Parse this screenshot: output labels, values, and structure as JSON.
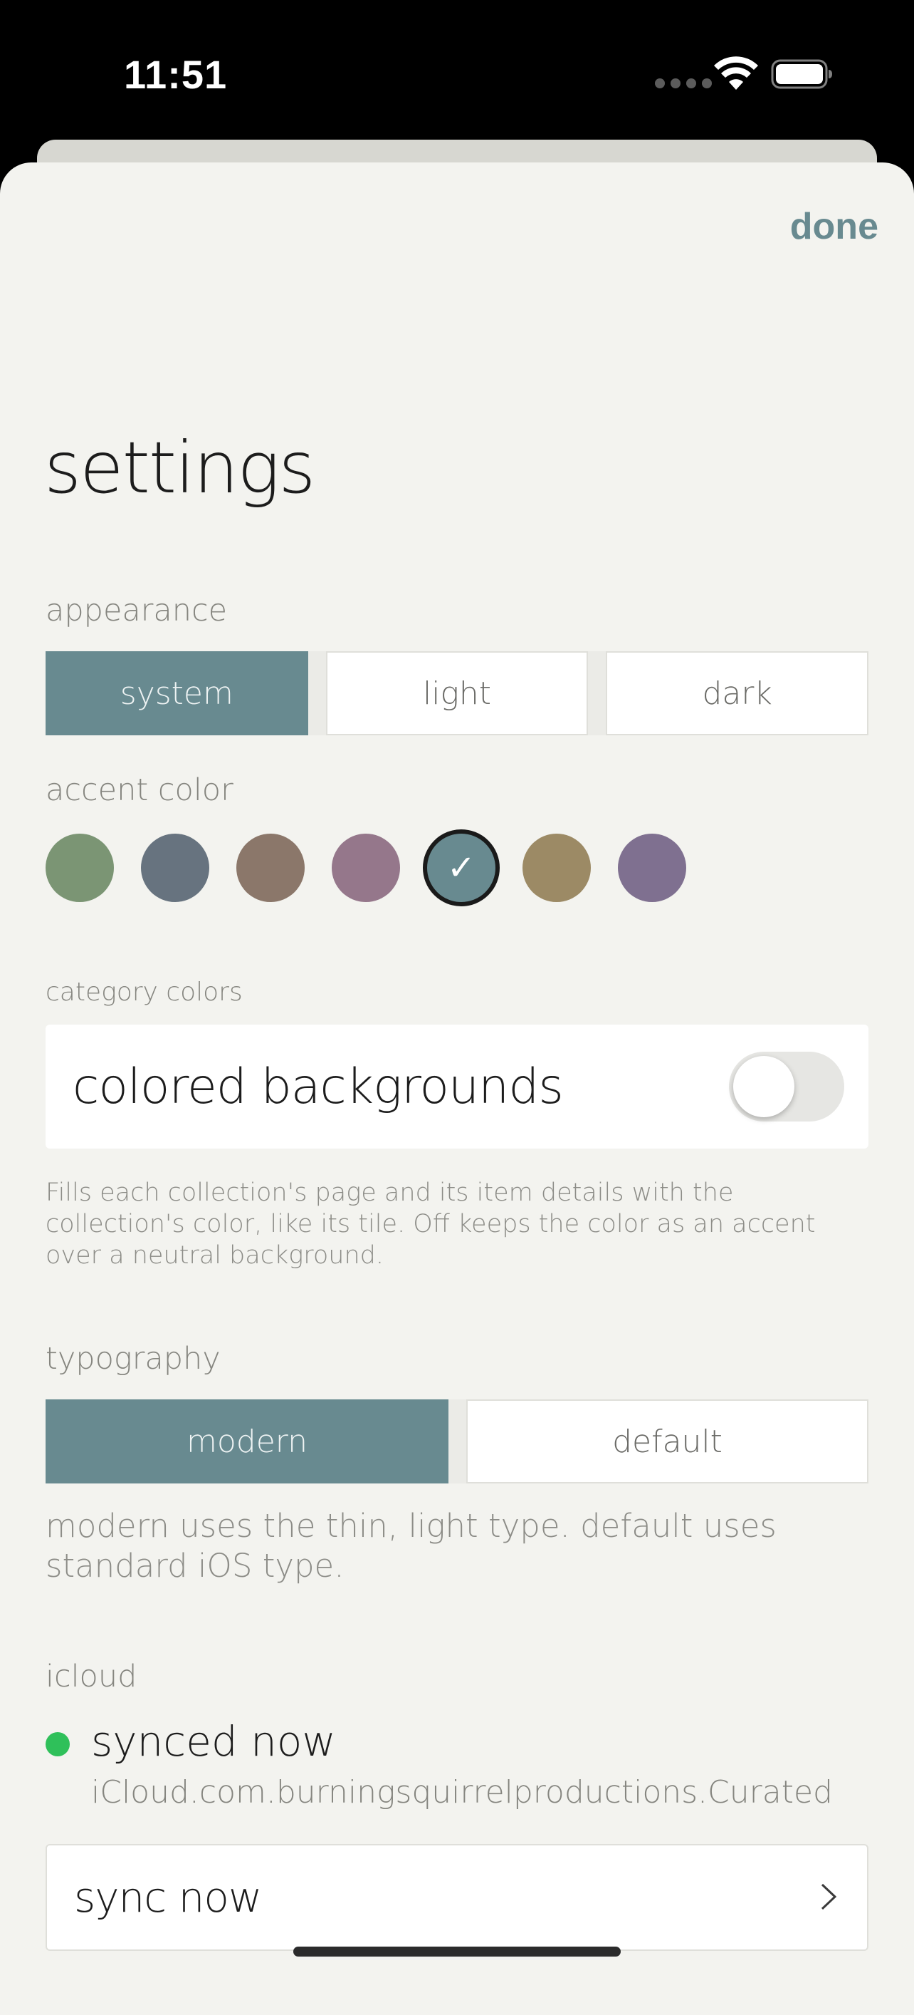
{
  "status_bar": {
    "time": "11:51"
  },
  "header": {
    "done_label": "done"
  },
  "title": "settings",
  "appearance": {
    "label": "appearance",
    "options": [
      "system",
      "light",
      "dark"
    ],
    "selected": "system"
  },
  "accent": {
    "label": "accent color",
    "colors": [
      "#7b9574",
      "#67737f",
      "#8b776a",
      "#95778b",
      "#688a90",
      "#9c8a65",
      "#7f7090"
    ],
    "selected_index": 4
  },
  "category": {
    "label": "category colors",
    "toggle_label": "colored backgrounds",
    "toggle_on": false,
    "help": "Fills each collection's page and its item details with the collection's color, like its tile. Off keeps the color as an accent over a neutral background."
  },
  "typography": {
    "label": "typography",
    "options": [
      "modern",
      "default"
    ],
    "selected": "modern",
    "help": "modern uses the thin, light type. default uses standard iOS type."
  },
  "icloud": {
    "label": "icloud",
    "status": "synced now",
    "status_color": "#2fc05a",
    "container": "iCloud.com.burningsquirrelproductions.Curated",
    "sync_button": "sync now"
  },
  "colors": {
    "accent": "#688a90",
    "background": "#f3f3ef"
  }
}
